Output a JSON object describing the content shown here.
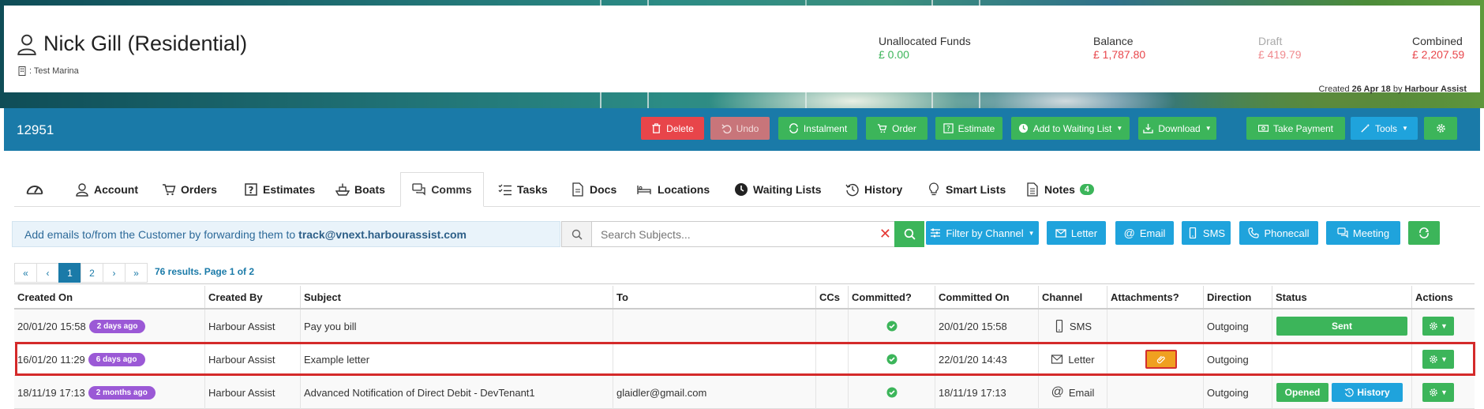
{
  "customer": {
    "name": "Nick Gill (Residential)",
    "marina": ": Test Marina"
  },
  "funds": {
    "unallocated_label": "Unallocated Funds",
    "unallocated_value": "£ 0.00",
    "balance_label": "Balance",
    "balance_value": "£ 1,787.80",
    "draft_label": "Draft",
    "draft_value": "£ 419.79",
    "combined_label": "Combined",
    "combined_value": "£ 2,207.59"
  },
  "created": {
    "prefix": "Created",
    "date": "26 Apr 18",
    "by_word": "by",
    "by": "Harbour Assist"
  },
  "record": {
    "id": "12951",
    "buttons": {
      "delete": "Delete",
      "undo": "Undo",
      "instalment": "Instalment",
      "order": "Order",
      "estimate": "Estimate",
      "waiting_list": "Add to Waiting List",
      "download": "Download",
      "take_payment": "Take Payment",
      "tools": "Tools"
    }
  },
  "tabs": {
    "account": "Account",
    "orders": "Orders",
    "estimates": "Estimates",
    "boats": "Boats",
    "comms": "Comms",
    "tasks": "Tasks",
    "docs": "Docs",
    "locations": "Locations",
    "waiting_lists": "Waiting Lists",
    "history": "History",
    "smart_lists": "Smart Lists",
    "notes": "Notes",
    "notes_count": "4"
  },
  "comms": {
    "forward_text": "Add emails to/from the Customer by forwarding them to",
    "forward_email": "track@vnext.harbourassist.com",
    "search_placeholder": "Search Subjects...",
    "filter_label": "Filter by Channel",
    "letter": "Letter",
    "email": "Email",
    "sms": "SMS",
    "phonecall": "Phonecall",
    "meeting": "Meeting"
  },
  "pagination": {
    "first": "«",
    "prev": "‹",
    "page1": "1",
    "page2": "2",
    "next": "›",
    "last": "»",
    "results": "76 results. Page 1 of 2"
  },
  "table": {
    "headers": {
      "created_on": "Created On",
      "created_by": "Created By",
      "subject": "Subject",
      "to": "To",
      "ccs": "CCs",
      "committed": "Committed?",
      "committed_on": "Committed On",
      "channel": "Channel",
      "attachments": "Attachments?",
      "direction": "Direction",
      "status": "Status",
      "actions": "Actions"
    },
    "rows": [
      {
        "created_on": "20/01/20 15:58",
        "ago": "2 days ago",
        "created_by": "Harbour Assist",
        "subject": "Pay you bill",
        "to": "",
        "committed_on": "20/01/20 15:58",
        "channel": "SMS",
        "direction": "Outgoing",
        "status": "Sent"
      },
      {
        "created_on": "16/01/20 11:29",
        "ago": "6 days ago",
        "created_by": "Harbour Assist",
        "subject": "Example letter",
        "to": "",
        "committed_on": "22/01/20 14:43",
        "channel": "Letter",
        "direction": "Outgoing",
        "status": ""
      },
      {
        "created_on": "18/11/19 17:13",
        "ago": "2 months ago",
        "created_by": "Harbour Assist",
        "subject": "Advanced Notification of Direct Debit - DevTenant1",
        "to": "glaidler@gmail.com",
        "committed_on": "18/11/19 17:13",
        "channel": "Email",
        "direction": "Outgoing",
        "status": "Opened",
        "status2": "History"
      }
    ]
  },
  "colors": {
    "green": "#3cb55a",
    "red": "#e8454a",
    "cyan": "#1fa3dc",
    "teal": "#1a7aa8",
    "purple": "#9b59d6",
    "orange": "#f0a020"
  }
}
